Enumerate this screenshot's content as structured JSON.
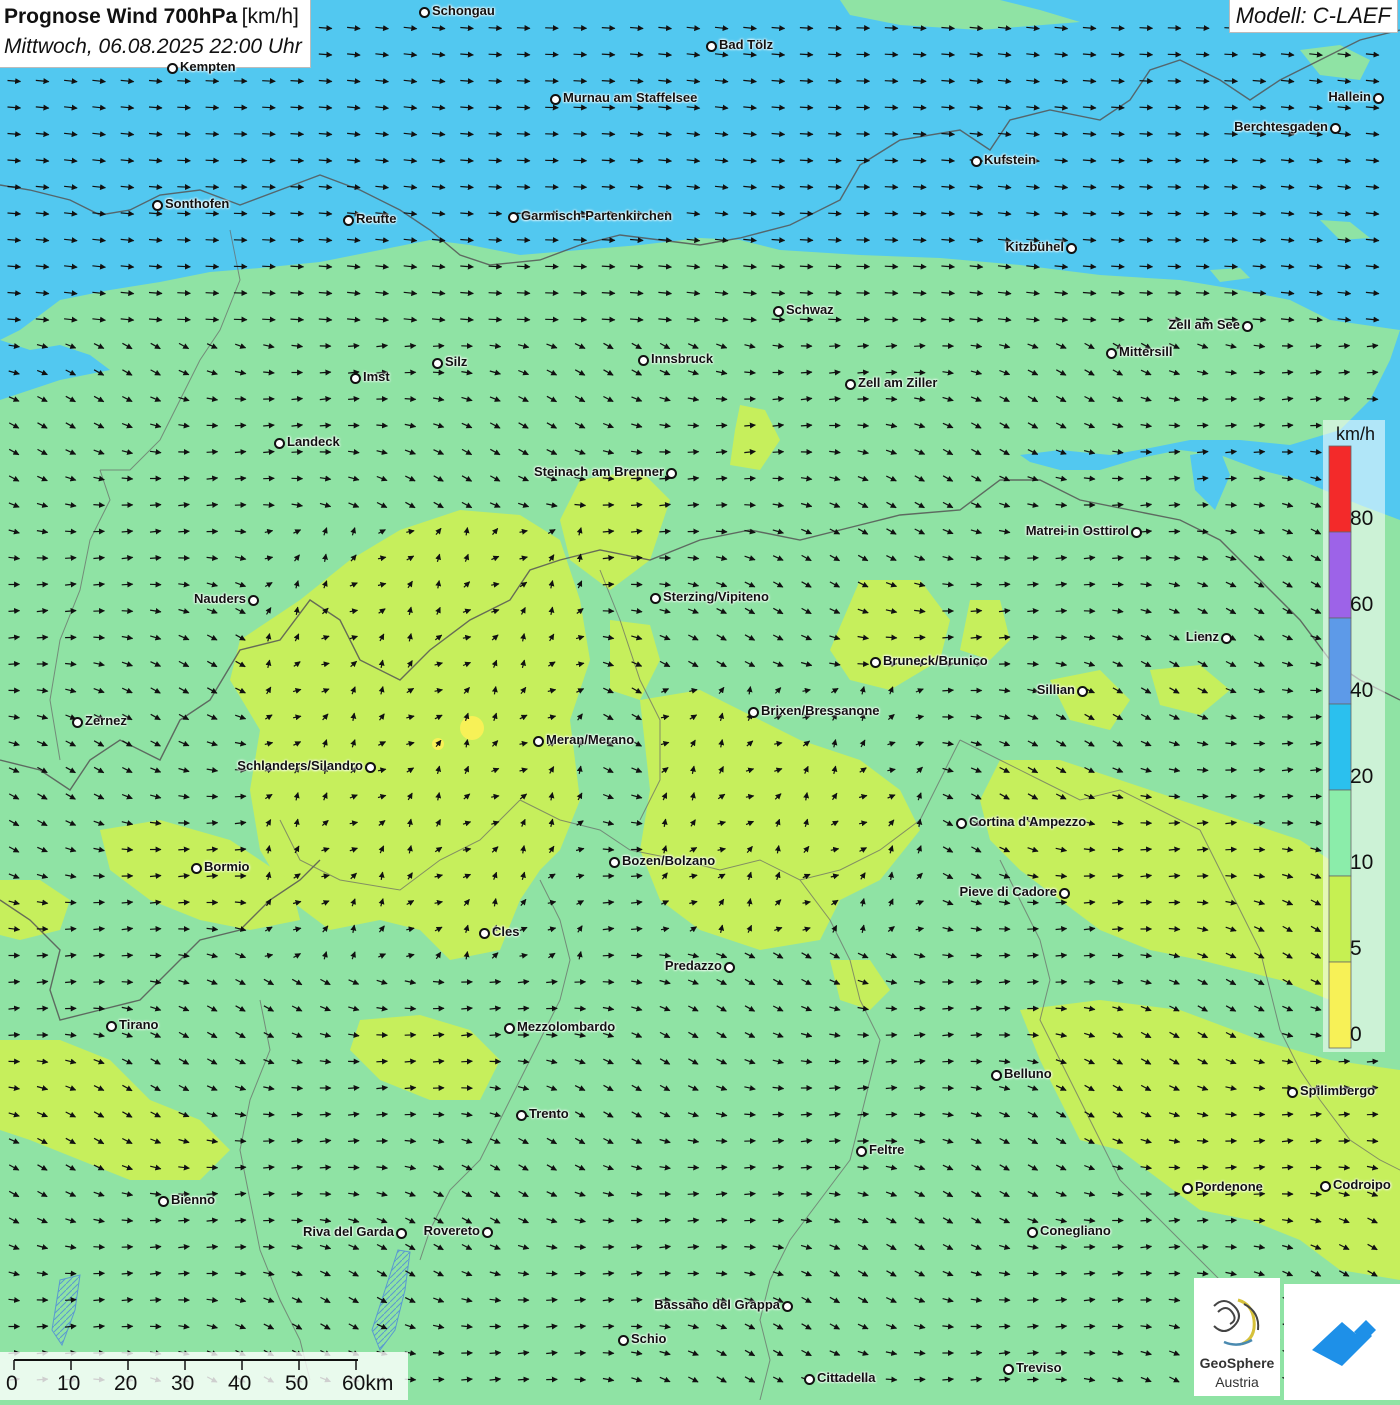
{
  "title": {
    "main": "Prognose Wind 700hPa",
    "unit": "[km/h]",
    "date": "Mittwoch, 06.08.2025 22:00 Uhr"
  },
  "model": "Modell: C-LAEF",
  "legend": {
    "unit": "km/h",
    "labels": [
      "80",
      "60",
      "40",
      "20",
      "10",
      "5",
      "0"
    ],
    "colors": [
      "#f32a2a",
      "#9d63e8",
      "#5d9ae8",
      "#2bc0ee",
      "#8bedaa",
      "#c6f052",
      "#f7f157"
    ]
  },
  "scalebar": {
    "labels": [
      "0",
      "10",
      "20",
      "30",
      "40",
      "50",
      "60km"
    ]
  },
  "logos": {
    "geosphere": "GeoSphere",
    "austria": "Austria",
    "icons": [
      "geosphere-logo-icon",
      "app-logo-icon"
    ]
  },
  "field_colors": {
    "strong": "#52c8f0",
    "moderate": "#8fe3a4",
    "weak": "#c6ef5c"
  },
  "cities": [
    {
      "name": "Schongau",
      "label_side": "right"
    },
    {
      "name": "Bad Tölz",
      "label_side": "right"
    },
    {
      "name": "Kempten",
      "label_side": "right"
    },
    {
      "name": "Murnau am Staffelsee",
      "label_side": "right"
    },
    {
      "name": "Hallein",
      "label_side": "left"
    },
    {
      "name": "Berchtesgaden",
      "label_side": "left"
    },
    {
      "name": "Kufstein",
      "label_side": "right"
    },
    {
      "name": "Sonthofen",
      "label_side": "right"
    },
    {
      "name": "Reutte",
      "label_side": "right"
    },
    {
      "name": "Garmisch-Partenkirchen",
      "label_side": "right"
    },
    {
      "name": "Kitzbühel",
      "label_side": "left"
    },
    {
      "name": "Schwaz",
      "label_side": "right"
    },
    {
      "name": "Zell am See",
      "label_side": "left"
    },
    {
      "name": "Mittersill",
      "label_side": "right"
    },
    {
      "name": "Innsbruck",
      "label_side": "right"
    },
    {
      "name": "Silz",
      "label_side": "right"
    },
    {
      "name": "Imst",
      "label_side": "right"
    },
    {
      "name": "Zell am Ziller",
      "label_side": "right"
    },
    {
      "name": "Landeck",
      "label_side": "right"
    },
    {
      "name": "Steinach am Brenner",
      "label_side": "left"
    },
    {
      "name": "Matrei in Osttirol",
      "label_side": "left"
    },
    {
      "name": "Nauders",
      "label_side": "left"
    },
    {
      "name": "Sterzing/Vipiteno",
      "label_side": "right"
    },
    {
      "name": "Lienz",
      "label_side": "left"
    },
    {
      "name": "Bruneck/Brunico",
      "label_side": "right"
    },
    {
      "name": "Sillian",
      "label_side": "left"
    },
    {
      "name": "Zernez",
      "label_side": "right"
    },
    {
      "name": "Brixen/Bressanone",
      "label_side": "right"
    },
    {
      "name": "Meran/Merano",
      "label_side": "right"
    },
    {
      "name": "Schlanders/Silandro",
      "label_side": "left"
    },
    {
      "name": "Cortina d'Ampezzo",
      "label_side": "right"
    },
    {
      "name": "Bozen/Bolzano",
      "label_side": "right"
    },
    {
      "name": "Bormio",
      "label_side": "right"
    },
    {
      "name": "Pieve di Cadore",
      "label_side": "left"
    },
    {
      "name": "Cles",
      "label_side": "right"
    },
    {
      "name": "Predazzo",
      "label_side": "left"
    },
    {
      "name": "Tirano",
      "label_side": "right"
    },
    {
      "name": "Mezzolombardo",
      "label_side": "right"
    },
    {
      "name": "Belluno",
      "label_side": "right"
    },
    {
      "name": "Spilimbergo",
      "label_side": "right"
    },
    {
      "name": "Trento",
      "label_side": "right"
    },
    {
      "name": "Feltre",
      "label_side": "right"
    },
    {
      "name": "Pordenone",
      "label_side": "right"
    },
    {
      "name": "Codroipo",
      "label_side": "right"
    },
    {
      "name": "Bienno",
      "label_side": "right"
    },
    {
      "name": "Riva del Garda",
      "label_side": "left"
    },
    {
      "name": "Rovereto",
      "label_side": "left"
    },
    {
      "name": "Conegliano",
      "label_side": "right"
    },
    {
      "name": "Bassano del Grappa",
      "label_side": "left"
    },
    {
      "name": "Schio",
      "label_side": "right"
    },
    {
      "name": "Treviso",
      "label_side": "right"
    },
    {
      "name": "Cittadella",
      "label_side": "right"
    }
  ]
}
